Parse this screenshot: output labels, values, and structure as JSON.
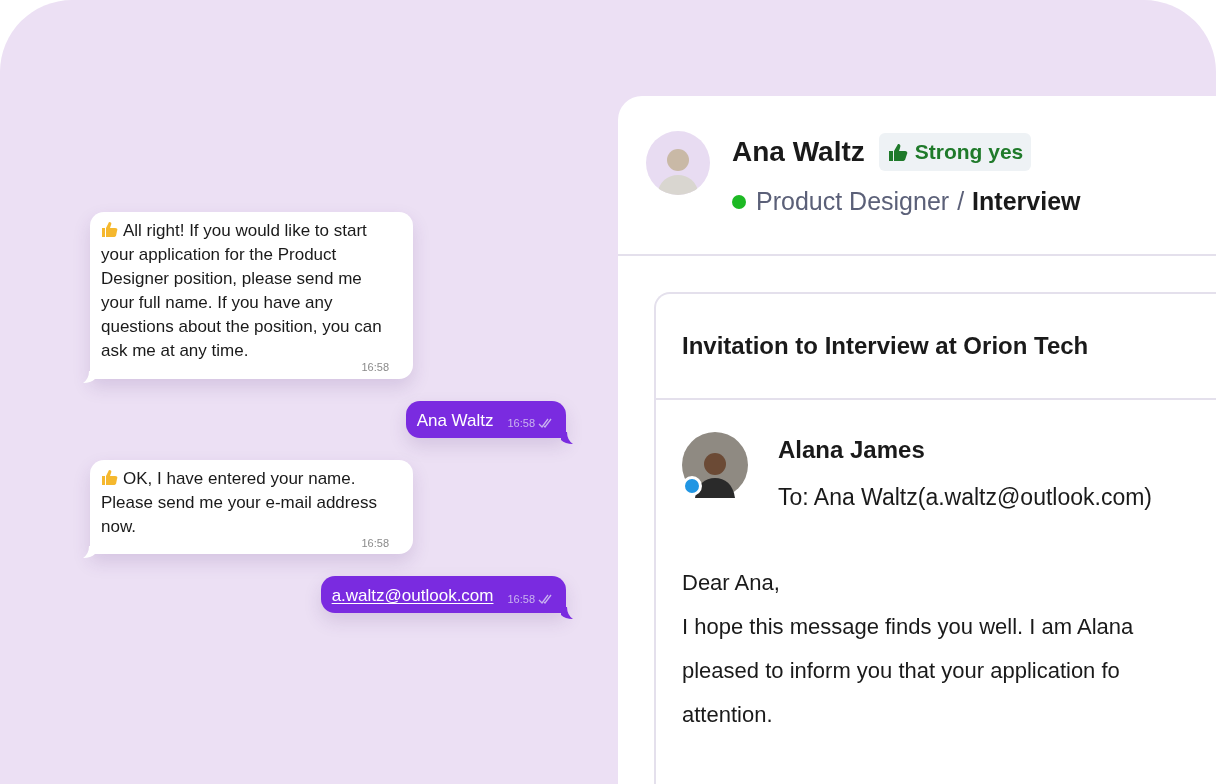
{
  "chat": [
    {
      "kind": "incoming",
      "thumbs_up": true,
      "text": "All right! If you would like to start your application for the Product Designer position, please send me your full name. If you have any questions about the position, you can ask me at any time.",
      "time": "16:58",
      "link": false
    },
    {
      "kind": "outgoing",
      "thumbs_up": false,
      "text": "Ana Waltz",
      "time": "16:58",
      "link": false,
      "read": true
    },
    {
      "kind": "incoming",
      "thumbs_up": true,
      "text": "OK, I have entered your name. Please send me your e-mail address now.",
      "time": "16:58",
      "link": false
    },
    {
      "kind": "outgoing",
      "thumbs_up": false,
      "text": "a.waltz@outlook.com",
      "time": "16:58",
      "link": true,
      "read": true
    }
  ],
  "candidate": {
    "name": "Ana Waltz",
    "badge": "Strong yes",
    "active": true,
    "role": "Product Designer",
    "separator": "/",
    "stage": "Interview"
  },
  "email": {
    "subject": "Invitation to Interview at Orion Tech",
    "sender": "Alana James",
    "sender_online": true,
    "to": "To: Ana Waltz(a.waltz@outlook.com)",
    "body": [
      "Dear Ana,",
      "I hope this message finds you well. I am Alana",
      "pleased to inform you that your application fo",
      "attention."
    ]
  }
}
